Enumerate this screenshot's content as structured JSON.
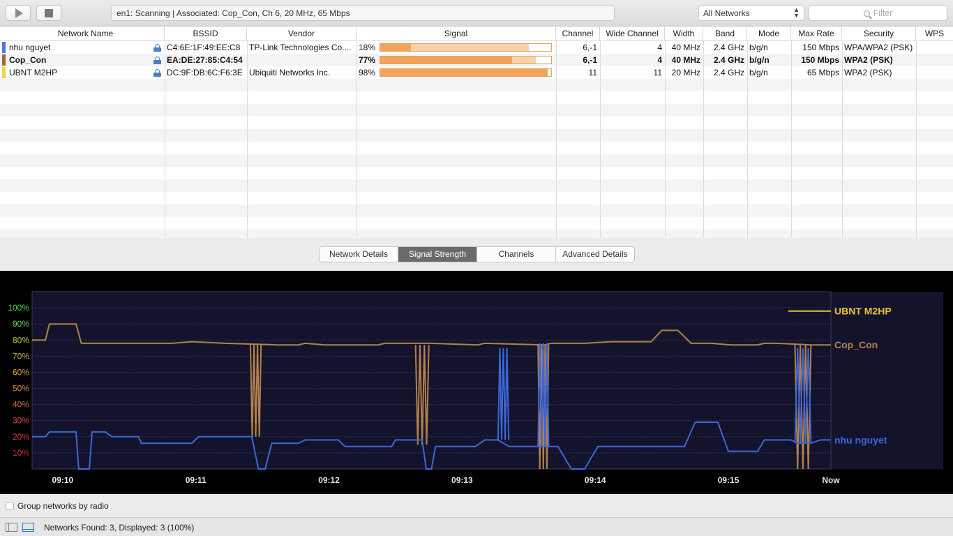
{
  "toolbar": {
    "play_icon": "play-icon",
    "stop_icon": "stop-icon",
    "status": "en1: Scanning  |  Associated: Cop_Con, Ch 6, 20 MHz, 65 Mbps",
    "networks_filter": "All Networks",
    "search_placeholder": "Filter"
  },
  "table": {
    "columns": [
      "Network Name",
      "BSSID",
      "Vendor",
      "Signal",
      "Channel",
      "Wide Channel",
      "Width",
      "Band",
      "Mode",
      "Max Rate",
      "Security",
      "WPS"
    ],
    "rows": [
      {
        "color": "#4a78e6",
        "name": "nhu nguyet",
        "bssid": "C4:6E:1F:49:EE:C8",
        "vendor": "TP-Link Technologies Co....",
        "signal": "18%",
        "signal_current": 0.18,
        "signal_average": 0.87,
        "channel": "6,-1",
        "wide_channel": "4",
        "width": "40 MHz",
        "band": "2.4 GHz",
        "mode": "b/g/n",
        "max_rate": "150 Mbps",
        "security": "WPA/WPA2 (PSK)",
        "wps": "",
        "bold": false
      },
      {
        "color": "#9c6a3c",
        "name": "Cop_Con",
        "bssid": "EA:DE:27:85:C4:54",
        "vendor": "",
        "signal": "77%",
        "signal_current": 0.77,
        "signal_average": 0.91,
        "channel": "6,-1",
        "wide_channel": "4",
        "width": "40 MHz",
        "band": "2.4 GHz",
        "mode": "b/g/n",
        "max_rate": "150 Mbps",
        "security": "WPA2 (PSK)",
        "wps": "",
        "bold": true
      },
      {
        "color": "#f1d54a",
        "name": "UBNT M2HP",
        "bssid": "DC:9F:DB:6C:F6:3E",
        "vendor": "Ubiquiti Networks Inc.",
        "signal": "98%",
        "signal_current": 0.98,
        "signal_average": 0.98,
        "channel": "11",
        "wide_channel": "11",
        "width": "20 MHz",
        "band": "2.4 GHz",
        "mode": "b/g/n",
        "max_rate": "65 Mbps",
        "security": "WPA2 (PSK)",
        "wps": "",
        "bold": false
      }
    ]
  },
  "tabs": [
    "Network Details",
    "Signal Strength",
    "Channels",
    "Advanced Details"
  ],
  "active_tab": "Signal Strength",
  "chart_data": {
    "type": "line",
    "title": "",
    "xlabel": "",
    "ylabel": "",
    "ylim": [
      0,
      110
    ],
    "y_ticks": [
      "100%",
      "90%",
      "80%",
      "70%",
      "60%",
      "50%",
      "40%",
      "30%",
      "20%",
      "10%"
    ],
    "y_tick_colors": [
      "#4fd34f",
      "#6fd34f",
      "#a8c943",
      "#c9b043",
      "#d7a140",
      "#d58a3c",
      "#d1703a",
      "#cf5135",
      "#cc3b2d",
      "#c92b26"
    ],
    "x_ticks": [
      "09:10",
      "09:11",
      "09:12",
      "09:13",
      "09:14",
      "09:15",
      "Now"
    ],
    "x_tick_positions": [
      0.23,
      1.23,
      2.23,
      3.23,
      4.23,
      5.23,
      6.0
    ],
    "series": [
      {
        "name": "UBNT M2HP",
        "color": "#e7c43b",
        "points": [
          [
            5.68,
            98
          ],
          [
            6.0,
            98
          ]
        ]
      },
      {
        "name": "Cop_Con",
        "color": "#b4804a",
        "points": [
          [
            0,
            80
          ],
          [
            0.1,
            80
          ],
          [
            0.13,
            90
          ],
          [
            0.33,
            90
          ],
          [
            0.37,
            78
          ],
          [
            0.75,
            78
          ],
          [
            0.78,
            78
          ],
          [
            1.05,
            78
          ],
          [
            1.2,
            79
          ],
          [
            1.45,
            78
          ],
          [
            1.85,
            77
          ],
          [
            1.87,
            77
          ],
          [
            2.0,
            77
          ],
          [
            2.05,
            78
          ],
          [
            2.2,
            77
          ],
          [
            2.5,
            77
          ],
          [
            2.6,
            77
          ],
          [
            2.65,
            78
          ],
          [
            3.0,
            78
          ],
          [
            3.35,
            77
          ],
          [
            3.4,
            78
          ],
          [
            3.85,
            77
          ],
          [
            3.9,
            78
          ],
          [
            4.05,
            78
          ],
          [
            4.15,
            78
          ],
          [
            4.35,
            79
          ],
          [
            4.65,
            79
          ],
          [
            4.73,
            86
          ],
          [
            4.85,
            86
          ],
          [
            4.95,
            78
          ],
          [
            5.05,
            78
          ],
          [
            5.1,
            78
          ],
          [
            5.25,
            77
          ],
          [
            5.45,
            77
          ],
          [
            5.5,
            78
          ],
          [
            5.6,
            78
          ],
          [
            5.85,
            77
          ],
          [
            5.95,
            77
          ],
          [
            6.0,
            77
          ]
        ],
        "glitches": [
          [
            1.64,
            1.72,
            77,
            20
          ],
          [
            2.88,
            2.98,
            77,
            15
          ],
          [
            3.8,
            3.88,
            77,
            0
          ],
          [
            5.73,
            5.85,
            77,
            0
          ]
        ]
      },
      {
        "name": "nhu nguyet",
        "color": "#3c67d9",
        "points": [
          [
            0,
            20
          ],
          [
            0.1,
            20
          ],
          [
            0.13,
            23
          ],
          [
            0.33,
            23
          ],
          [
            0.35,
            0
          ],
          [
            0.43,
            0
          ],
          [
            0.45,
            23
          ],
          [
            0.55,
            23
          ],
          [
            0.6,
            20
          ],
          [
            0.8,
            20
          ],
          [
            0.82,
            16
          ],
          [
            1.2,
            16
          ],
          [
            1.25,
            20
          ],
          [
            1.65,
            20
          ],
          [
            1.7,
            0
          ],
          [
            1.75,
            0
          ],
          [
            1.8,
            16
          ],
          [
            2.0,
            16
          ],
          [
            2.05,
            18
          ],
          [
            2.3,
            18
          ],
          [
            2.35,
            14
          ],
          [
            2.7,
            14
          ],
          [
            2.73,
            18
          ],
          [
            2.93,
            18
          ],
          [
            2.96,
            0
          ],
          [
            3.0,
            0
          ],
          [
            3.03,
            14
          ],
          [
            3.33,
            14
          ],
          [
            3.4,
            18
          ],
          [
            3.5,
            18
          ],
          [
            3.58,
            14
          ],
          [
            3.85,
            14
          ],
          [
            3.95,
            14
          ],
          [
            4.05,
            0
          ],
          [
            4.15,
            0
          ],
          [
            4.25,
            14
          ],
          [
            4.5,
            14
          ],
          [
            4.55,
            14
          ],
          [
            4.9,
            14
          ],
          [
            4.98,
            29
          ],
          [
            5.15,
            29
          ],
          [
            5.23,
            11
          ],
          [
            5.45,
            11
          ],
          [
            5.5,
            18
          ],
          [
            5.7,
            18
          ],
          [
            5.75,
            16
          ],
          [
            5.85,
            16
          ],
          [
            5.92,
            18
          ],
          [
            6.0,
            18
          ]
        ],
        "glitches": [
          [
            3.5,
            3.58,
            18,
            75
          ],
          [
            3.8,
            3.88,
            14,
            78
          ],
          [
            5.73,
            5.85,
            16,
            75
          ]
        ]
      }
    ]
  },
  "group_networks": "Group networks by radio",
  "status": "Networks Found: 3, Displayed: 3 (100%)"
}
